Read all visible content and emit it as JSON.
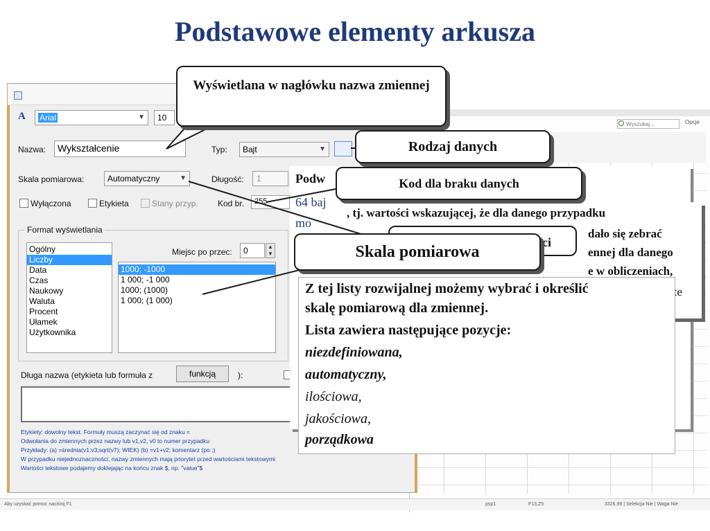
{
  "slide": {
    "title": "Podstawowe elementy arkusza"
  },
  "background_window": {
    "search_placeholder": "Wyszukaj...",
    "options_label": "Opcje",
    "status_left": "Aby uzyskać pomoc naciśnij F1",
    "status_mid": "psp1",
    "status_mid2": "F13,Z5",
    "status_right": "3326,99 | Selekcja Nie | Waga Nie"
  },
  "dialog": {
    "font_icon": "A",
    "font_name": "Arial",
    "font_size": "10",
    "nazwa_label": "Nazwa:",
    "nazwa_value": "Wykształcenie",
    "typ_label": "Typ:",
    "typ_value": "Bajt",
    "skala_label": "Skala pomiarowa:",
    "skala_value": "Automatyczny",
    "dlugosc_label": "Długość:",
    "dlugosc_value": "1",
    "wylaczona_label": "Wyłączona",
    "etykieta_label": "Etykieta",
    "stany_label": "Stany przyp.",
    "kod_label": "Kod br.",
    "kod_value": "255",
    "format_group_label": "Format wyświetlania",
    "format_items": [
      "Ogólny",
      "Liczby",
      "Data",
      "Czas",
      "Naukowy",
      "Waluta",
      "Procent",
      "Ułamek",
      "Użytkownika"
    ],
    "format_selected_index": 1,
    "miejsc_label": "Miejsc po przec:",
    "miejsc_value": "0",
    "number_formats": [
      "1000; -1000",
      "1 000; -1 000",
      "1000; (1000)",
      "1 000; (1 000)"
    ],
    "number_selected_index": 0,
    "dluga_label": "Długa nazwa (etykieta lub formuła z",
    "funkcja_label": "funkcją",
    "colon_label": "):",
    "help_lines": [
      "Etykiety:  dowolny tekst. Formuły muszą zaczynać się od znaku =",
      "Odwołania do zmiennych przez nazwy lub v1,v2, v0 to numer przypadku",
      "Przykłady: (a) =średnia(v1:v3;sqrt(v7); WIEK) (b) =v1+v2; komentarz (po ;)",
      "W przypadku niejednoznaczności, nazwy zmiennych mają priorytet przed wartościami tekstowymi",
      "Wartości tekstowe podajemy dokleјając na końcu znak $, np. \"value\"$"
    ]
  },
  "callouts": {
    "naglowek": "Wyświetlana w nagłówku nazwa zmiennej",
    "rodzaj": "Rodzaj danych",
    "kod": "Kod dla braku danych",
    "skala": "Skala pomiarowa"
  },
  "info_boxes": {
    "box1_line1": "Podw",
    "box1_line2": "64 baj",
    "box1_line3": "mo",
    "box2_line1": ", tj. wartości wskazującej, że dla danego przypadku",
    "box2_line2": "dało się zebrać",
    "box2_line3": "ennej dla danego",
    "box2_line4": "e w obliczeniach,",
    "box2_tail_c": "ci",
    "box2_tail_ste": "ste",
    "skala_desc_1": "Z tej listy rozwijalnej możemy wybrać i określić",
    "skala_desc_2": "skalę pomiarową dla zmiennej.",
    "skala_desc_3": "Lista zawiera następujące pozycje:",
    "skala_items": [
      "niezdefiniowana,",
      "automatyczny,",
      "ilościowa,",
      "jakościowa,",
      "porządkowa"
    ]
  }
}
